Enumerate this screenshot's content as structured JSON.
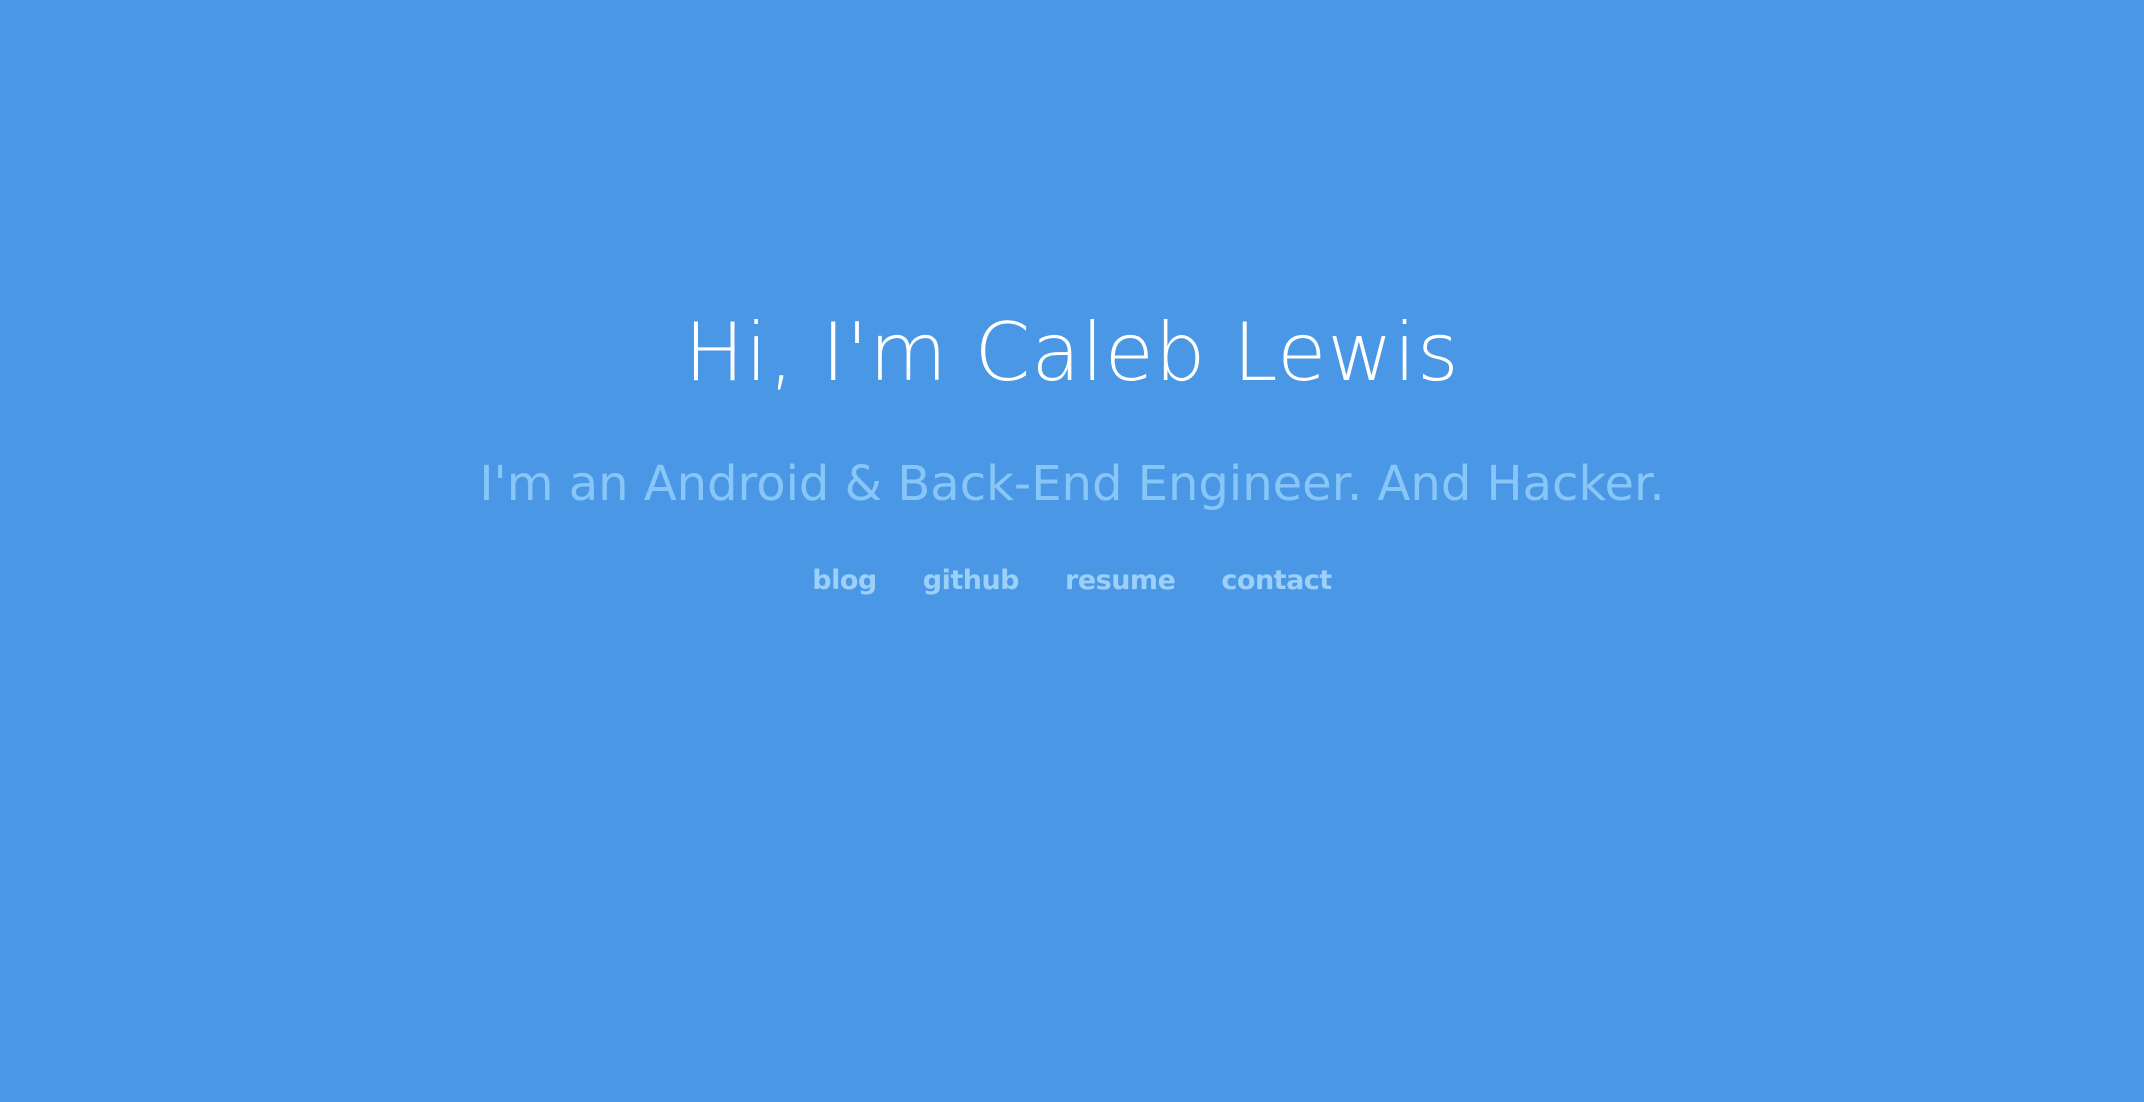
{
  "hero": {
    "title": "Hi, I'm Caleb Lewis",
    "subtitle": "I'm an Android & Back-End Engineer. And Hacker."
  },
  "nav": {
    "links": [
      {
        "label": "blog"
      },
      {
        "label": "github"
      },
      {
        "label": "resume"
      },
      {
        "label": "contact"
      }
    ]
  },
  "colors": {
    "background": "#4A98E5",
    "title": "#FFFFFF",
    "subtitle": "#88C6F8",
    "links": "#9DD0F8"
  }
}
